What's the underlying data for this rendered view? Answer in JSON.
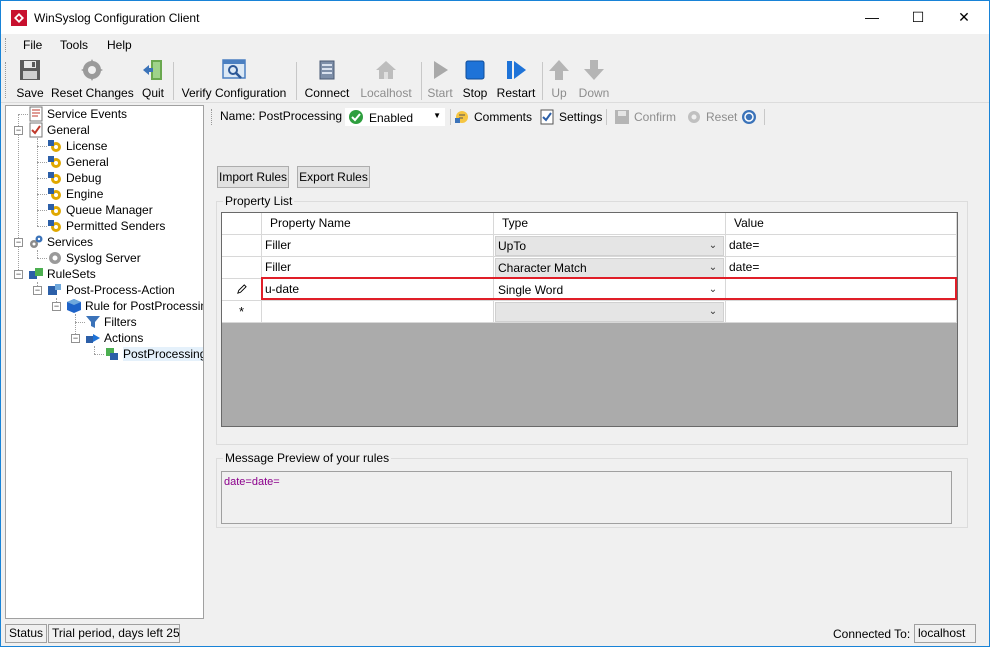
{
  "window": {
    "title": "WinSyslog Configuration Client"
  },
  "menu": [
    "File",
    "Tools",
    "Help"
  ],
  "toolbar": {
    "save": "Save",
    "reset_changes": "Reset Changes",
    "quit": "Quit",
    "verify_configuration": "Verify Configuration",
    "connect": "Connect",
    "localhost": "Localhost",
    "start": "Start",
    "stop": "Stop",
    "restart": "Restart",
    "up": "Up",
    "down": "Down"
  },
  "tree": {
    "service_events": "Service Events",
    "general": "General",
    "license": "License",
    "general_sub": "General",
    "debug": "Debug",
    "engine": "Engine",
    "queue_manager": "Queue Manager",
    "permitted_senders": "Permitted Senders",
    "services": "Services",
    "syslog_server": "Syslog Server",
    "rulesets": "RuleSets",
    "post_process_action": "Post-Process-Action",
    "rule_for_postprocessing": "Rule for PostProcessing",
    "filters": "Filters",
    "actions": "Actions",
    "postprocessing": "PostProcessing"
  },
  "action_bar": {
    "name": "Name: PostProcessing",
    "enabled": "Enabled",
    "comments": "Comments",
    "settings": "Settings",
    "confirm": "Confirm",
    "reset": "Reset"
  },
  "buttons": {
    "import_rules": "Import Rules",
    "export_rules": "Export Rules"
  },
  "property_list": {
    "legend": "Property List",
    "columns": [
      "Property Name",
      "Type",
      "Value"
    ],
    "rows": [
      {
        "name": "Filler",
        "type": "UpTo",
        "value": "date="
      },
      {
        "name": "Filler",
        "type": "Character Match",
        "value": "date="
      },
      {
        "name": "u-date",
        "type": "Single Word",
        "value": ""
      }
    ],
    "new_row_marker": "*"
  },
  "message_preview": {
    "legend": "Message Preview of your rules",
    "text": "date=date="
  },
  "status": {
    "status_label": "Status",
    "trial": "Trial period, days left 25",
    "connected_to_label": "Connected To:",
    "connected_to_value": "localhost"
  },
  "colors": {
    "highlight": "#e01e28",
    "preview_text": "#8b008b",
    "window_border": "#1883d7"
  }
}
